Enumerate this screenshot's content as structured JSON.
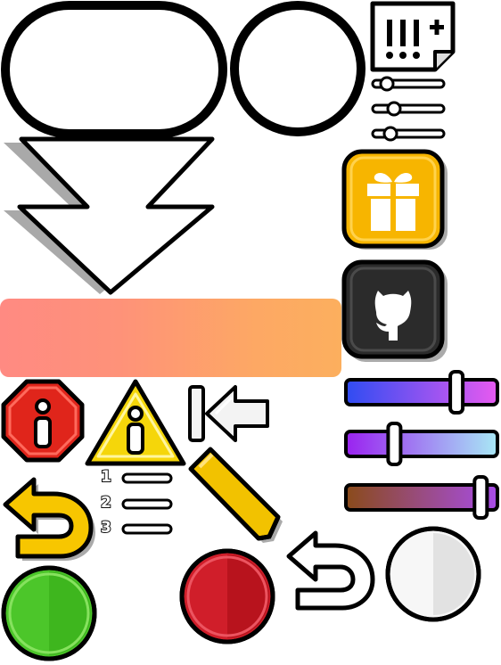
{
  "sheet": {
    "colors": {
      "outline": "#000000",
      "shadow": "#b3b3b3",
      "gift_yellow": "#f7b500",
      "github_dark": "#2b2b2b",
      "error_red": "#e0251b",
      "warning_yellow": "#f5d60a",
      "pencil_yellow": "#f2c200",
      "green": "#4cc62a",
      "red": "#c8161f",
      "white_button": "#f3f3f3"
    },
    "list_numbers": [
      "1",
      "2",
      "3"
    ],
    "sliders": [
      {
        "name": "blue-magenta",
        "from": "#2f4cf2",
        "to": "#e75af0",
        "level": 0.73
      },
      {
        "name": "purple-cyan",
        "from": "#9a22f0",
        "to": "#a8e8f5",
        "level": 0.32
      },
      {
        "name": "brown-violet",
        "from": "#8a4b1a",
        "to": "#a84ce8",
        "level": 0.89
      }
    ],
    "settings_sliders": [
      0.2,
      0.3,
      0.25
    ],
    "icons": [
      "rounded-pill-frame",
      "circle-frame",
      "notes-add-icon",
      "settings-sliders-icon",
      "double-arrow-down-icon",
      "gift-icon",
      "github-icon",
      "gradient-bar",
      "error-icon",
      "warning-icon",
      "skip-back-icon",
      "numbered-list-icon",
      "pencil-icon",
      "undo-icon",
      "green-button",
      "red-button",
      "white-undo-icon",
      "white-button"
    ]
  }
}
